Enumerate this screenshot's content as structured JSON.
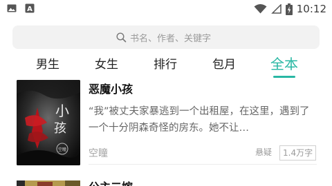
{
  "status_bar": {
    "time": "10:12",
    "icons": [
      "image-icon",
      "font-icon",
      "wifi-icon",
      "signal-icon",
      "battery-icon"
    ]
  },
  "search": {
    "placeholder": "书名、作者、关键字"
  },
  "tabs": [
    {
      "label": "男生",
      "active": false
    },
    {
      "label": "女生",
      "active": false
    },
    {
      "label": "排行",
      "active": false
    },
    {
      "label": "包月",
      "active": false
    },
    {
      "label": "全本",
      "active": true
    }
  ],
  "accent_color": "#28b7a3",
  "books": [
    {
      "title": "恶魔小孩",
      "description": "“我”被丈夫家暴逃到一个出租屋，在这里，遇到了一个十分阴森奇怪的房东。她不让…",
      "author": "空瞳",
      "genre": "悬疑",
      "word_count": "1.4万字",
      "cover_text": "恶魔小孩",
      "cover_author": "空瞳"
    },
    {
      "title": "公主二嫁"
    }
  ]
}
